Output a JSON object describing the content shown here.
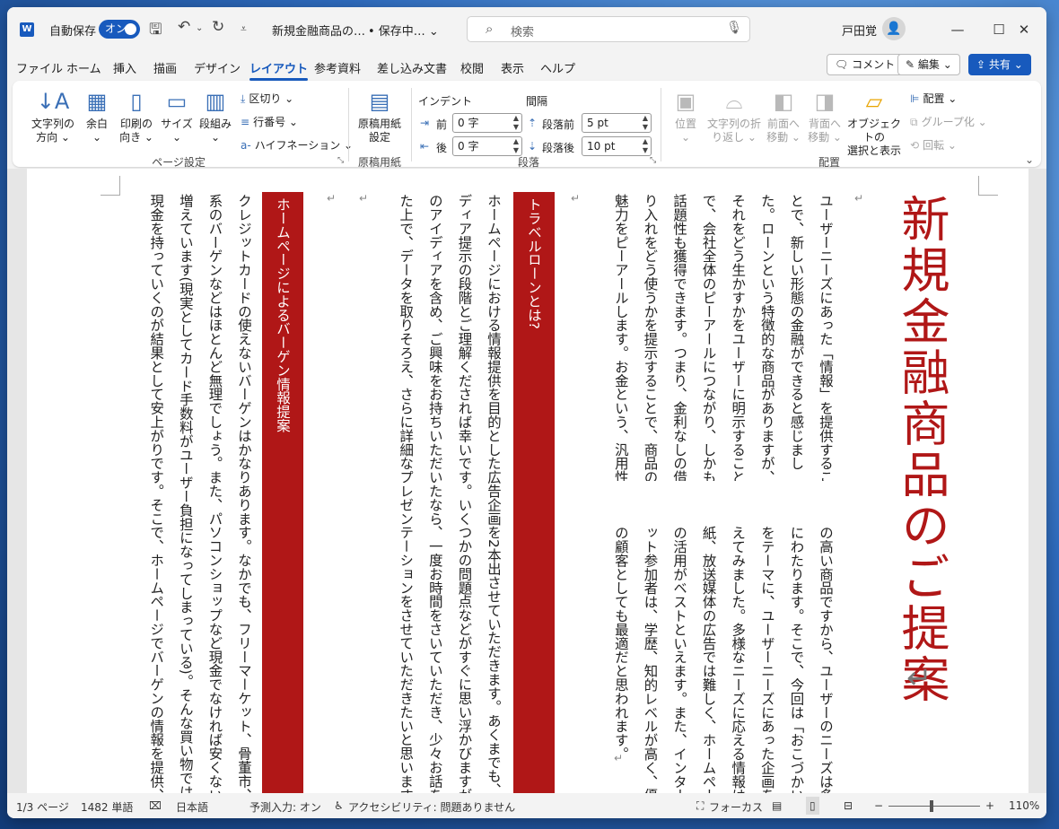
{
  "window": {
    "autosave_label": "自動保存",
    "autosave_toggle": "オン",
    "doc_title": "新規金融商品の…",
    "save_status": "• 保存中… ⌄",
    "search_placeholder": "検索",
    "user_name": "戸田覚"
  },
  "menu": {
    "tabs": [
      "ファイル",
      "ホーム",
      "挿入",
      "描画",
      "デザイン",
      "レイアウト",
      "参考資料",
      "差し込み文書",
      "校閲",
      "表示",
      "ヘルプ"
    ],
    "active_tab": "レイアウト",
    "comment_button": "コメント",
    "edit_button": "編集 ⌄",
    "share_button": "共有 ⌄"
  },
  "ribbon": {
    "page_setup": {
      "label": "ページ設定",
      "text_direction": "文字列の\n方向 ⌄",
      "margins": "余白\n⌄",
      "orientation": "印刷の\n向き ⌄",
      "size": "サイズ\n⌄",
      "columns": "段組み\n⌄",
      "breaks": "区切り ⌄",
      "line_numbers": "行番号 ⌄",
      "hyphenation": "ハイフネーション ⌄"
    },
    "genko": {
      "label": "原稿用紙",
      "button": "原稿用紙\n設定"
    },
    "paragraph": {
      "label": "段落",
      "indent_header": "インデント",
      "spacing_header": "間隔",
      "indent_before_label": "前",
      "indent_before_value": "0 字",
      "indent_after_label": "後",
      "indent_after_value": "0 字",
      "spacing_before_label": "段落前",
      "spacing_before_value": "5 pt",
      "spacing_after_label": "段落後",
      "spacing_after_value": "10 pt"
    },
    "arrange": {
      "label": "配置",
      "position": "位置\n⌄",
      "wrap_text": "文字列の折\nり返し ⌄",
      "bring_forward": "前面へ\n移動 ⌄",
      "send_backward": "背面へ\n移動 ⌄",
      "selection_pane": "オブジェクトの\n選択と表示",
      "align": "配置 ⌄",
      "group": "グループ化 ⌄",
      "rotate": "回転 ⌄"
    }
  },
  "document": {
    "title": "新規金融商品のご提案",
    "section1_col1": [
      "ユーザーニーズにあった「情報」を提供するこ",
      "とで、新しい形態の金融ができると感じまし",
      "た。ローンという特徴的な商品がありますが、",
      "それをどう生かすかをユーザーに明示すること",
      "で、会社全体のピーアールにつながり、しかも",
      "話題性も獲得できます。つまり、金利なしの借",
      "り入れをどう使うかを提示することで、商品の",
      "魅力をピーアールします。お金という、汎用性"
    ],
    "section1_col2": [
      "の高い商品ですから、ユーザーのニーズは多",
      "にわたります。そこで、今回は「おこづかい",
      "をテーマに、ユーザーニーズにあった企画を",
      "えてみました。多様なニーズに応える情報は",
      "紙、放送媒体の広告では難しく、ホームペー",
      "の活用がベストといえます。また、インター",
      "ット参加者は、学歴、知的レベルが高く、優",
      "の顧客としても最適だと思われます。"
    ],
    "heading1": "トラベルローンとは?",
    "section2": [
      "ホームページにおける情報提供を目的とした広告企画を2本出させていただきます。あくまでも、ア",
      "ディア提示の段階とご理解くだされば幸いです。いくつかの問題点などがすぐに思い浮かびますが、",
      "のアイディアを含め、ご興味をお持ちいただいたなら、一度お時間をさいていただき、少々お話を伺",
      "た上で、データを取りそろえ、さらに詳細なプレゼンテーションをさせていただきたいと思います。"
    ],
    "heading2": "ホームページによるバーゲン情報提案",
    "section3": [
      "クレジットカードの使えないバーゲンはかなりあります。なかでも、フリーマーケット、骨董市、問",
      "系のバーゲンなどはほとんど無理でしょう。また、パソコンショップなど現金でなければ安くない店",
      "増えています(現実としてカード手数料がユーザー負担になってしまっている)。そんな買い物では",
      "現金を持っていくのが結果として安上がりです。そこで、ホームページでバーゲンの情報を提供、そ"
    ]
  },
  "status": {
    "page": "1/3 ページ",
    "words": "1482 単語",
    "language": "日本語",
    "predict": "予測入力: オン",
    "accessibility": "アクセシビリティ: 問題ありません",
    "focus": "フォーカス",
    "zoom_minus": "−",
    "zoom_plus": "+",
    "zoom": "110%",
    "zoom_level_percent": 110
  },
  "colors": {
    "accent": "#185abd",
    "heading_red": "#b01717"
  }
}
